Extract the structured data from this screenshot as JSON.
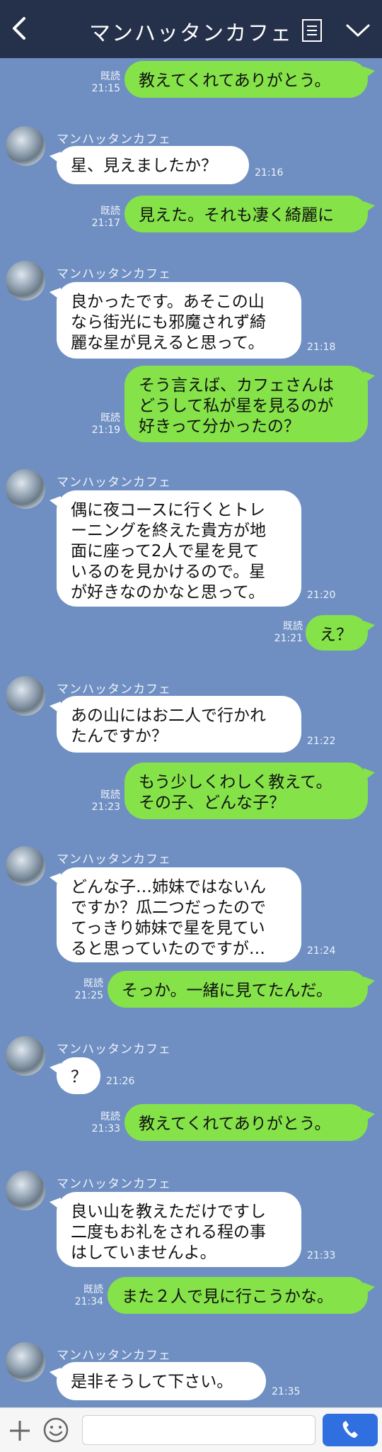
{
  "header": {
    "title": "マンハッタンカフェ"
  },
  "sender_name": "マンハッタンカフェ",
  "read_label": "既読",
  "messages": [
    {
      "dir": "out",
      "text": "教えてくれてありがとう。",
      "time": "21:15"
    },
    {
      "dir": "in",
      "text": "星、見えましたか？",
      "time": "21:16"
    },
    {
      "dir": "out",
      "text": "見えた。それも凄く綺麗に",
      "time": "21:17"
    },
    {
      "dir": "in",
      "text": "良かったです。あそこの山\nなら街光にも邪魔されず綺\n麗な星が見えると思って。",
      "time": "21:18"
    },
    {
      "dir": "out",
      "text": "そう言えば、カフェさんは\nどうして私が星を見るのが\n好きって分かったの？",
      "time": "21:19"
    },
    {
      "dir": "in",
      "text": "偶に夜コースに行くとトレ\nーニングを終えた貴方が地\n面に座って2人で星を見て\nいるのを見かけるので。星\nが好きなのかなと思って。",
      "time": "21:20"
    },
    {
      "dir": "out",
      "text": "え？",
      "time": "21:21"
    },
    {
      "dir": "in",
      "text": "あの山にはお二人で行かれ\nたんですか？",
      "time": "21:22"
    },
    {
      "dir": "out",
      "text": "もう少しくわしく教えて。\nその子、どんな子？",
      "time": "21:23"
    },
    {
      "dir": "in",
      "text": "どんな子…姉妹ではないん\nですか？瓜二つだったので\nてっきり姉妹で星を見てい\nると思っていたのですが…",
      "time": "21:24"
    },
    {
      "dir": "out",
      "text": "そっか。一緒に見てたんだ。",
      "time": "21:25"
    },
    {
      "dir": "in",
      "text": "？",
      "time": "21:26"
    },
    {
      "dir": "out",
      "text": "教えてくれてありがとう。",
      "time": "21:33"
    },
    {
      "dir": "in",
      "text": "良い山を教えただけですし\n二度もお礼をされる程の事\nはしていませんよ。",
      "time": "21:33"
    },
    {
      "dir": "out",
      "text": "また２人で見に行こうかな。",
      "time": "21:34"
    },
    {
      "dir": "in",
      "text": "是非そうして下さい。",
      "time": "21:35"
    }
  ],
  "composer": {
    "value": ""
  }
}
